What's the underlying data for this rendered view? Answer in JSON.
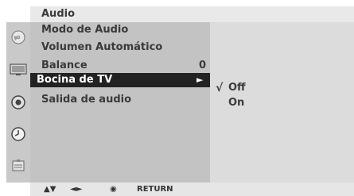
{
  "menu": {
    "title": "Audio",
    "items": [
      {
        "label": "Modo de Audio",
        "value": ""
      },
      {
        "label": "Volumen Automático",
        "value": ""
      },
      {
        "label": "Balance",
        "value": "0"
      },
      {
        "label": "Bocina de TV",
        "value": ""
      },
      {
        "label": "Salida de audio",
        "value": ""
      }
    ],
    "selected_index": 3,
    "selected_arrow": "►"
  },
  "submenu": {
    "check_mark": "√",
    "options": [
      "Off",
      "On"
    ],
    "selected": "Off"
  },
  "side_icons": [
    "audio-disc-icon",
    "tv-screen-icon",
    "sound-circle-icon",
    "clock-icon",
    "lock-icon"
  ],
  "footer": {
    "nav_updown": "▲▼",
    "nav_leftright": "◄►",
    "ok_symbol": "◉",
    "return_label": "RETURN"
  },
  "colors": {
    "highlight_bg": "#222222",
    "menu_bg": "#c3c3c3",
    "submenu_bg": "#dcdcdc",
    "text": "#3a3a3a"
  }
}
